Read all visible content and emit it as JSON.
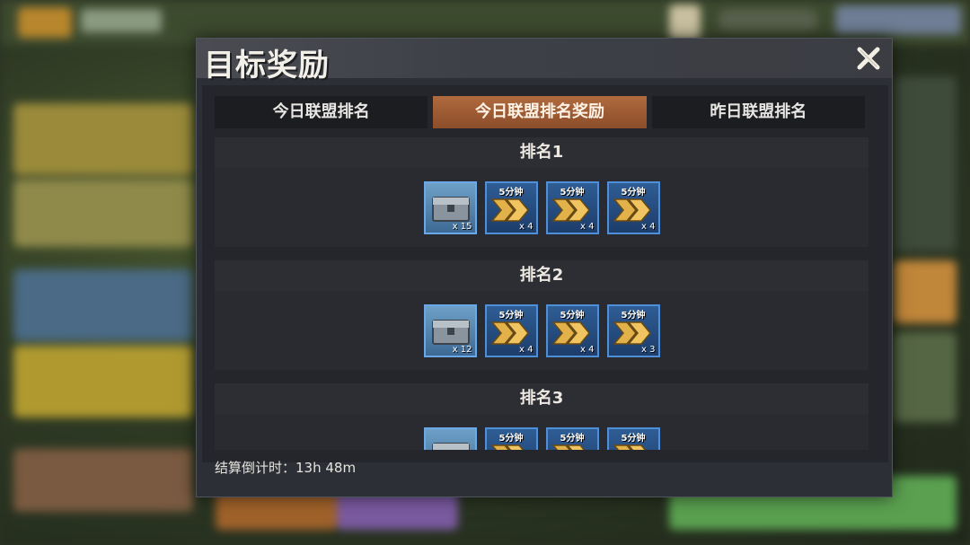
{
  "modal": {
    "title": "目标奖励",
    "close_icon": "close-x-icon"
  },
  "tabs": [
    {
      "label": "今日联盟排名",
      "active": false
    },
    {
      "label": "今日联盟排名奖励",
      "active": true
    },
    {
      "label": "昨日联盟排名",
      "active": false
    }
  ],
  "ranks": [
    {
      "label": "排名1",
      "rewards": [
        {
          "type": "chest",
          "icon": "supply-chest-icon",
          "label": "",
          "qty": "x 15"
        },
        {
          "type": "speedup",
          "icon": "speedup-chevron-icon",
          "label": "5分钟",
          "qty": "x 4"
        },
        {
          "type": "speedup",
          "icon": "speedup-chevron-icon",
          "label": "5分钟",
          "qty": "x 4"
        },
        {
          "type": "speedup",
          "icon": "speedup-chevron-icon",
          "label": "5分钟",
          "qty": "x 4"
        }
      ]
    },
    {
      "label": "排名2",
      "rewards": [
        {
          "type": "chest",
          "icon": "supply-chest-icon",
          "label": "",
          "qty": "x 12"
        },
        {
          "type": "speedup",
          "icon": "speedup-chevron-icon",
          "label": "5分钟",
          "qty": "x 4"
        },
        {
          "type": "speedup",
          "icon": "speedup-chevron-icon",
          "label": "5分钟",
          "qty": "x 4"
        },
        {
          "type": "speedup",
          "icon": "speedup-chevron-icon",
          "label": "5分钟",
          "qty": "x 3"
        }
      ]
    },
    {
      "label": "排名3",
      "rewards": [
        {
          "type": "chest",
          "icon": "supply-chest-icon",
          "label": "",
          "qty": ""
        },
        {
          "type": "speedup",
          "icon": "speedup-chevron-icon",
          "label": "5分钟",
          "qty": ""
        },
        {
          "type": "speedup",
          "icon": "speedup-chevron-icon",
          "label": "5分钟",
          "qty": ""
        },
        {
          "type": "speedup",
          "icon": "speedup-chevron-icon",
          "label": "5分钟",
          "qty": ""
        }
      ]
    }
  ],
  "footer": {
    "countdown": "结算倒计时：13h 48m"
  },
  "colors": {
    "active_tab": "#a05c34",
    "item_border": "#4f8fd8",
    "panel_bg": "#2c2f36"
  }
}
